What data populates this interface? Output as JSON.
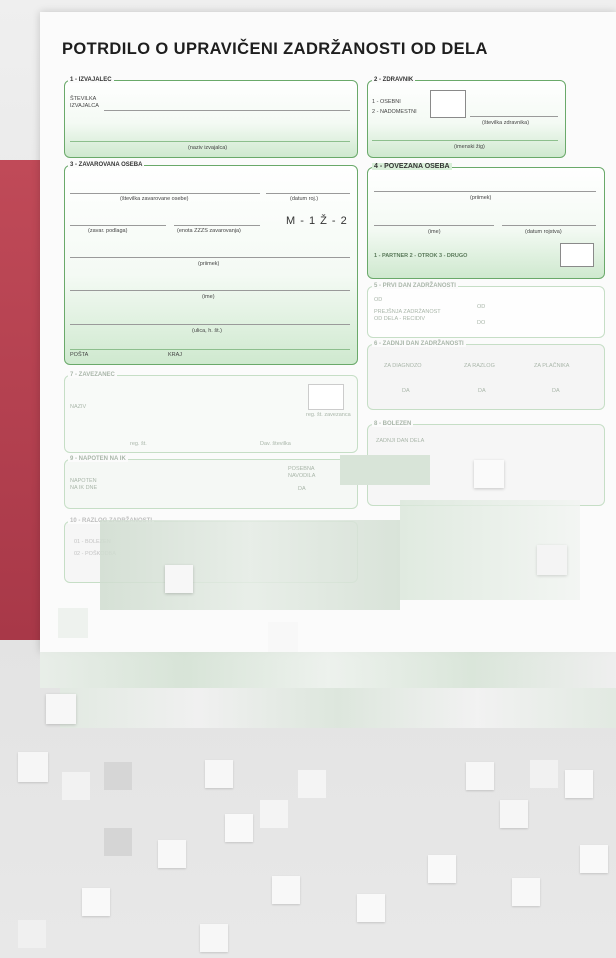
{
  "form": {
    "title": "POTRDILO O UPRAVIČENI ZADRŽANOSTI OD DELA",
    "s1": {
      "heading": "1 - IZVAJALEC",
      "number_label_line1": "ŠTEVILKA",
      "number_label_line2": "IZVAJALCA",
      "name_caption": "(naziv izvajalca)"
    },
    "s2": {
      "heading": "2 - ZDRAVNIK",
      "opt1": "1 - OSEBNI",
      "opt2": "2 - NADOMESTNI",
      "num_caption": "(številka zdravnika)",
      "stamp_caption": "(imenski žig)"
    },
    "s3": {
      "heading": "3 - ZAVAROVANA OSEBA",
      "cap_number": "(številka zavarovane osebe)",
      "cap_dob": "(datum roj.)",
      "cap_basis": "(zavar. podlaga)",
      "cap_unit": "(enota ZZZS zavarovanja)",
      "sex": "M - 1    Ž - 2",
      "cap_surname": "(priimek)",
      "cap_name": "(ime)",
      "cap_address": "(ulica, h. št.)",
      "post": "POŠTA",
      "place": "KRAJ"
    },
    "s4": {
      "heading": "4 - POVEZANA OSEBA",
      "cap_surname": "(priimek)",
      "cap_name": "(ime)",
      "cap_dob": "(datum rojstva)",
      "relation": "1 - PARTNER   2 - OTROK   3 - DRUGO"
    },
    "s5": {
      "heading": "5 - PRVI DAN ZADRŽANOSTI",
      "od": "OD",
      "prev_line1": "PREJŠNJA ZADRŽANOST",
      "prev_line2": "OD DELA - RECIDIV",
      "od2": "OD",
      "do2": "DO"
    },
    "s6": {
      "heading": "6 - ZADNJI DAN ZADRŽANOSTI",
      "col1": "ZA DIAGNOZO",
      "col2": "ZA RAZLOG",
      "col3": "ZA PLAČNIKA",
      "da1": "DA",
      "da2": "DA",
      "da3": "DA"
    },
    "s7": {
      "heading": "7 - ZAVEZANEC",
      "name_label": "NAZIV",
      "cap_stamp": "reg. št. zavezanca",
      "cap_reg": "reg. št.",
      "cap_tax": "Dav. številka"
    },
    "s8": {
      "heading": "8 - BOLEZEN",
      "line1": "ZADNJI DAN DELA"
    },
    "s9": {
      "heading": "9 - NAPOTEN NA IK",
      "line1": "NAPOTEN",
      "line2": "NA IK DNE",
      "box_line1": "POSEBNA",
      "box_line2": "NAVODILA",
      "box_line3": "DA"
    },
    "s10": {
      "heading": "10 - RAZLOG ZADRŽANOSTI",
      "item1": "01 - BOLEZEN",
      "item2": "02 - POŠKODBA"
    }
  },
  "colors": {
    "form_green": "#6aa96a",
    "band_red": "#b84454"
  }
}
